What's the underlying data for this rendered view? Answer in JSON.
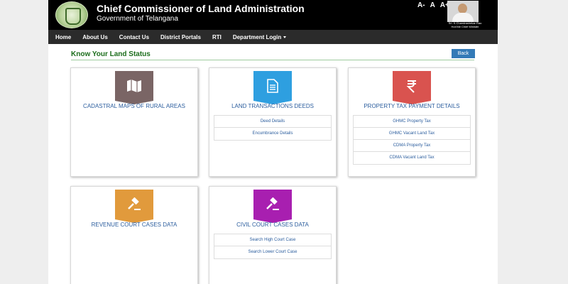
{
  "header": {
    "title": "Chief Commissioner of Land Administration",
    "subtitle": "Government of Telangana",
    "font_controls": [
      "A-",
      "A",
      "A+"
    ],
    "cm_name": "Sri. K.Chandrashekar Rao",
    "cm_role": "Hon'ble Chief Minister"
  },
  "nav": {
    "items": [
      "Home",
      "About Us",
      "Contact Us",
      "District Portals",
      "RTI",
      "Department Login"
    ]
  },
  "section": {
    "title": "Know Your Land Status",
    "back_label": "Back"
  },
  "cards": [
    {
      "title": "CADASTRAL MAPS OF RURAL AREAS",
      "icon": "map-icon",
      "color": "#7a6565",
      "links": []
    },
    {
      "title": "LAND TRANSACTIONS DEEDS",
      "icon": "document-icon",
      "color": "#2e9fe0",
      "links": [
        "Deed Details",
        "Encumbrance Details"
      ]
    },
    {
      "title": "PROPERTY TAX PAYMENT DETAILS",
      "icon": "rupee-icon",
      "color": "#d9534f",
      "links": [
        "GHMC Property Tax",
        "GHMC Vacant Land Tax",
        "CDMA Property Tax",
        "CDMA Vacant Land Tax"
      ]
    },
    {
      "title": "REVENUE COURT CASES DATA",
      "icon": "gavel-icon",
      "color": "#e19a3c",
      "links": []
    },
    {
      "title": "CIVIL COURT CASES DATA",
      "icon": "gavel-icon",
      "color": "#a81fb0",
      "links": [
        "Search High Court Case",
        "Search Lower Court Case"
      ]
    }
  ]
}
